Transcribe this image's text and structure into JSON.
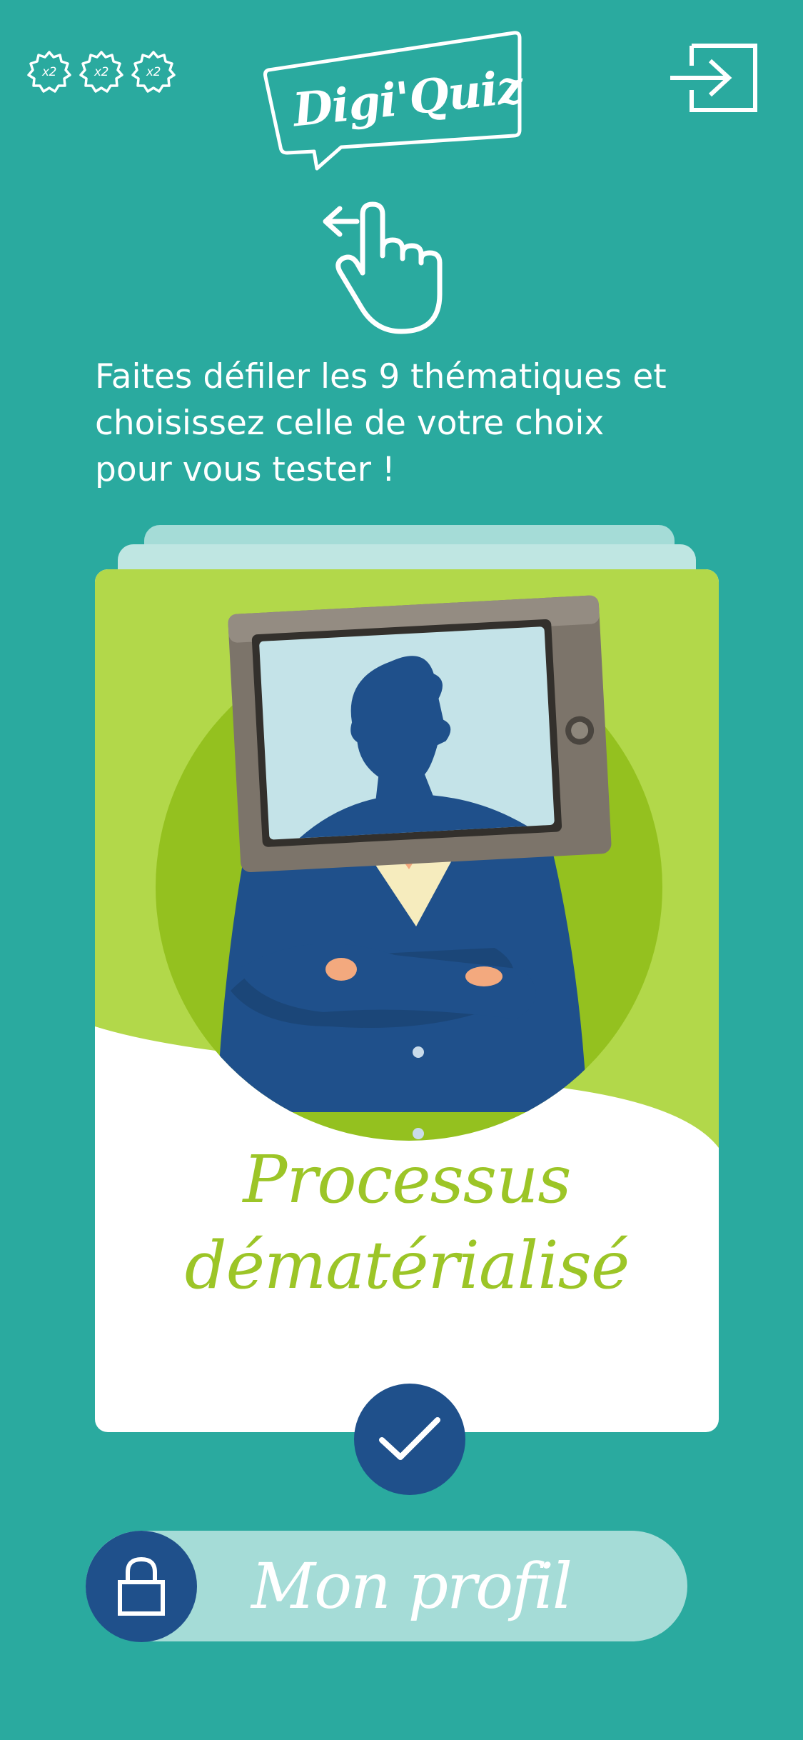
{
  "header": {
    "badges": [
      {
        "label": "x2",
        "icon": "multiplier-badge-icon"
      },
      {
        "label": "x2",
        "icon": "multiplier-badge-icon"
      },
      {
        "label": "x2",
        "icon": "multiplier-badge-icon"
      }
    ],
    "logo_text": "Digi'Quiz",
    "logout_icon": "sign-in-arrow-icon"
  },
  "instruction": {
    "icon": "swipe-hand-icon",
    "line1": "Faites défiler les 9 thématiques et",
    "line2": "choisissez celle de votre choix",
    "line3": "pour vous tester !"
  },
  "card": {
    "title_line1": "Processus",
    "title_line2": "dématérialisé",
    "illustration": "tv-head-businessman"
  },
  "select_button": {
    "icon": "checkmark-icon"
  },
  "profile": {
    "label": "Mon profil",
    "icon": "lock-icon"
  },
  "colors": {
    "background": "#2aaa9f",
    "accent_green": "#9cc527",
    "navy": "#1f508b",
    "pale_teal": "#a5dcd7"
  }
}
